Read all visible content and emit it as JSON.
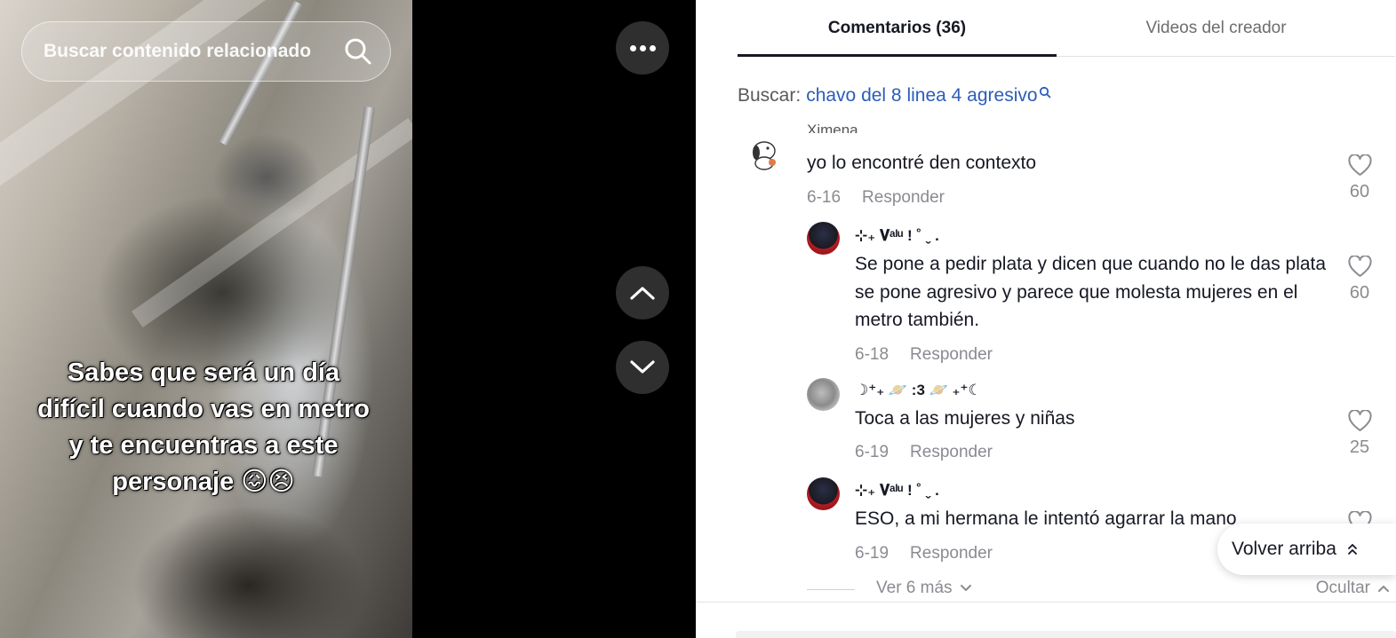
{
  "video": {
    "search_placeholder": "Buscar contenido relacionado",
    "caption": "Sabes que será un día difícil cuando vas en metro y te encuentras a este personaje 😖😣"
  },
  "tabs": [
    {
      "label": "Comentarios (36)",
      "active": true
    },
    {
      "label": "Videos del creador",
      "active": false
    }
  ],
  "search": {
    "prefix": "Buscar:",
    "query": "chavo del 8 linea 4 agresivo"
  },
  "comments": {
    "partial_username": "Ximena",
    "top": {
      "text": "yo lo encontré den contexto",
      "date": "6-16",
      "reply_label": "Responder",
      "likes": "60"
    },
    "replies": [
      {
        "username": "⊹₊ 𝐕ᵃˡᵘ ! ˚ ˬ .",
        "text": "Se pone a pedir plata y dicen que cuando no le das plata se pone agresivo y parece que molesta mujeres en el metro también.",
        "date": "6-18",
        "reply_label": "Responder",
        "likes": "60"
      },
      {
        "username": "☽⁺₊ 🪐 :3 🪐 ₊⁺☾",
        "text": "Toca a las mujeres y niñas",
        "date": "6-19",
        "reply_label": "Responder",
        "likes": "25"
      },
      {
        "username": "⊹₊ 𝐕ᵃˡᵘ ! ˚ ˬ .",
        "text": "ESO, a mi hermana le intentó agarrar la mano",
        "date": "6-19",
        "reply_label": "Responder",
        "likes": ""
      }
    ],
    "view_more": "Ver 6 más",
    "hide": "Ocultar"
  },
  "back_to_top": "Volver arriba",
  "colors": {
    "link": "#2b5db8",
    "text": "#161823",
    "muted": "#8a8b91",
    "button_bg": "#2f2f2f"
  }
}
